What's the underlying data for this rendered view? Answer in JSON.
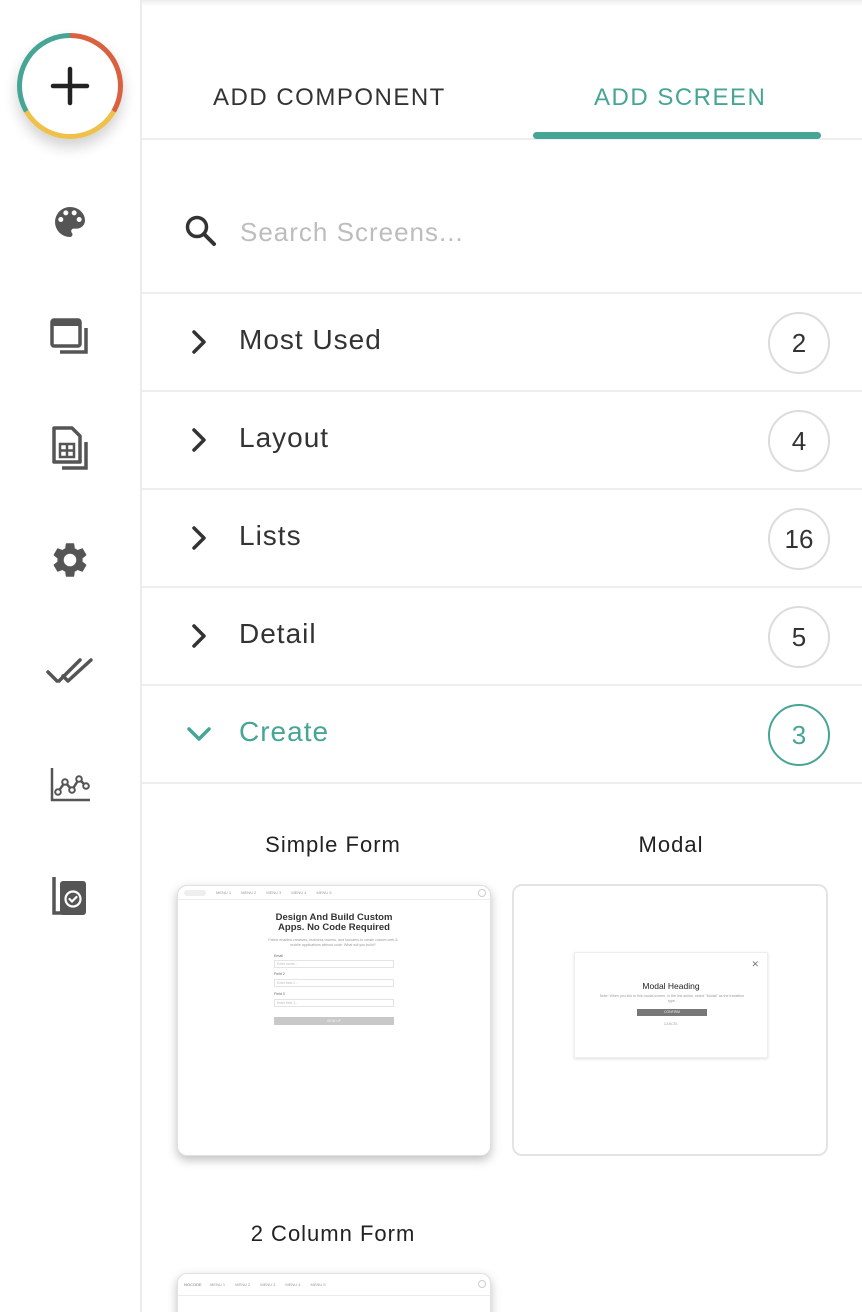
{
  "colors": {
    "accent": "#47a595",
    "fab_red": "#d9613f",
    "fab_yellow": "#efc04a",
    "icon_gray": "#555555"
  },
  "sidebar": {
    "add_button_icon": "plus-icon",
    "icons": [
      "palette-icon",
      "screens-icon",
      "data-table-icon",
      "gear-icon",
      "double-check-icon",
      "analytics-chart-icon",
      "published-document-icon"
    ]
  },
  "tabs": {
    "add_component": "ADD COMPONENT",
    "add_screen": "ADD SCREEN",
    "active": "ADD SCREEN"
  },
  "search": {
    "placeholder": "Search Screens...",
    "value": ""
  },
  "categories": [
    {
      "label": "Most Used",
      "count": "2",
      "expanded": false
    },
    {
      "label": "Layout",
      "count": "4",
      "expanded": false
    },
    {
      "label": "Lists",
      "count": "16",
      "expanded": false
    },
    {
      "label": "Detail",
      "count": "5",
      "expanded": false
    },
    {
      "label": "Create",
      "count": "3",
      "expanded": true
    }
  ],
  "screens": {
    "simple_form": {
      "title": "Simple Form",
      "preview": {
        "menus": [
          "MENU 1",
          "MENU 2",
          "MENU 3",
          "MENU 4",
          "MENU 5"
        ],
        "heading_line1": "Design And Build Custom",
        "heading_line2": "Apps. No Code Required",
        "body": "Fabric enables creatives, business owners, and founders to create custom web & mobile applications without code. What will you build?",
        "field1_label": "Email",
        "field1_placeholder": "Enter name...",
        "field2_label": "Field 2",
        "field2_placeholder": "Enter field 2...",
        "field3_label": "Field 3",
        "field3_placeholder": "Enter field 3...",
        "button": "SIGN UP"
      }
    },
    "modal": {
      "title": "Modal",
      "preview": {
        "heading": "Modal Heading",
        "body": "Note: When you link to this modal screen, in the link action, select \"Modal\" as the transition type.",
        "button": "CONFIRM",
        "link": "CANCEL"
      }
    },
    "two_column_form": {
      "title": "2 Column Form",
      "preview": {
        "logo": "NOCODE",
        "menus": [
          "MENU 1",
          "MENU 2",
          "MENU 3",
          "MENU 4",
          "MENU 5"
        ]
      }
    }
  }
}
